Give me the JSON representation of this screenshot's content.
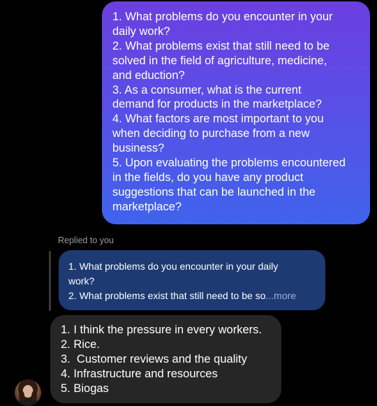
{
  "sent_message": {
    "lines": [
      "1. What problems do you encounter in your",
      "daily work?",
      "2. What problems exist that still need to be",
      "solved in the field of agriculture, medicine,",
      "and eduction?",
      "3. As a consumer, what is the current",
      "demand for products in the marketplace?",
      "4. What factors are most important to you",
      "when deciding to purchase from a new",
      "business?",
      "5. Upon evaluating the problems encountered",
      "in the fields, do you have any product",
      "suggestions that can be launched in the",
      "marketplace?"
    ]
  },
  "reply_context": {
    "label": "Replied to you",
    "quote_line_1": "1. What problems do you encounter in your daily",
    "quote_line_2": "work?",
    "quote_line_3": "2. What problems exist that still need to be so",
    "more_label": "...more"
  },
  "received_message": {
    "lines": [
      "1. I think the pressure in every workers.",
      "2. Rice.",
      "3.  Customer reviews and the quality",
      "4. Infrastructure and resources",
      "5. Biogas"
    ]
  },
  "colors": {
    "sent_gradient_top": "#6b3fe0",
    "sent_gradient_bottom": "#3f63ec",
    "quote_background": "#1d3a72",
    "received_background": "#262626"
  }
}
